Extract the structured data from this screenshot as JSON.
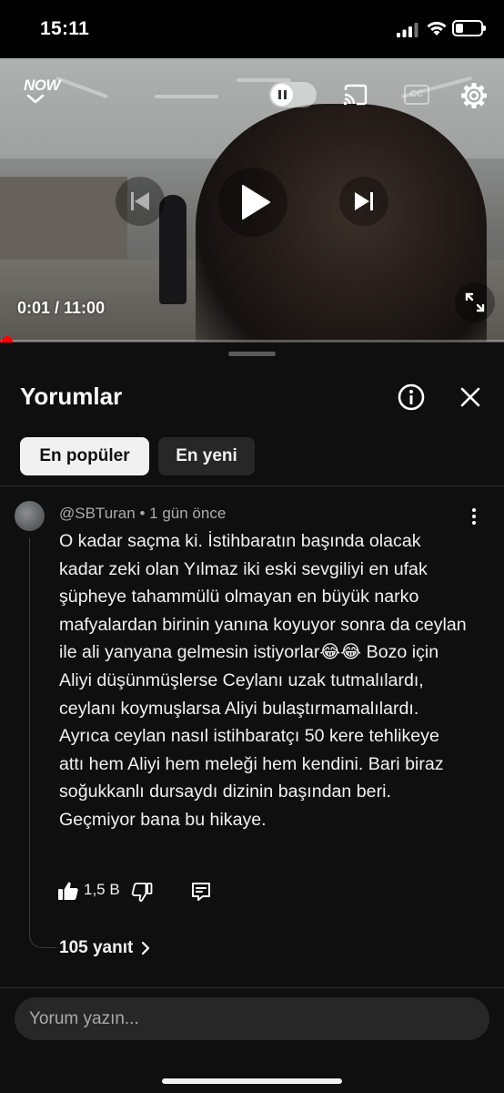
{
  "status_bar": {
    "time": "15:11",
    "battery_level": 0.3
  },
  "video": {
    "channel_logo": "NOW",
    "time_display": "0:01 / 11:00",
    "progress": 0.0015,
    "captions_label": "CC",
    "icons": [
      "chevron-down-icon",
      "pause-icon",
      "cast-icon",
      "cc-icon",
      "gear-icon",
      "skip-previous-icon",
      "play-icon",
      "skip-next-icon",
      "fullscreen-icon"
    ]
  },
  "comments_panel": {
    "title": "Yorumlar",
    "sort_chips": [
      {
        "label": "En popüler",
        "selected": true
      },
      {
        "label": "En yeni",
        "selected": false
      }
    ],
    "comment": {
      "author": "@SBTuran",
      "time_ago": "1 gün önce",
      "text": "O kadar saçma ki. İstihbaratın başında olacak kadar zeki olan Yılmaz iki eski sevgiliyi en ufak şüpheye tahammülü olmayan en büyük narko mafyalardan birinin yanına koyuyor sonra da ceylan ile ali yanyana gelmesin istiyorlar😂😂 Bozo için Aliyi düşünmüşlerse Ceylanı uzak tutmalılardı, ceylanı koymuşlarsa Aliyi bulaştırmamalılardı. Ayrıca ceylan nasıl istihbaratçı 50 kere tehlikeye attı hem Aliyi hem meleği hem kendini. Bari biraz soğukkanlı dursaydı dizinin başından beri. Geçmiyor bana bu hikaye.",
      "likes": "1,5 B",
      "replies_label": "105 yanıt"
    },
    "composer": {
      "placeholder": "Yorum yazın..."
    }
  },
  "colors": {
    "background": "#0f0f0f",
    "progress": "#ff0000",
    "chip_active_bg": "#f1f1f1",
    "chip_inactive_bg": "#272727"
  }
}
